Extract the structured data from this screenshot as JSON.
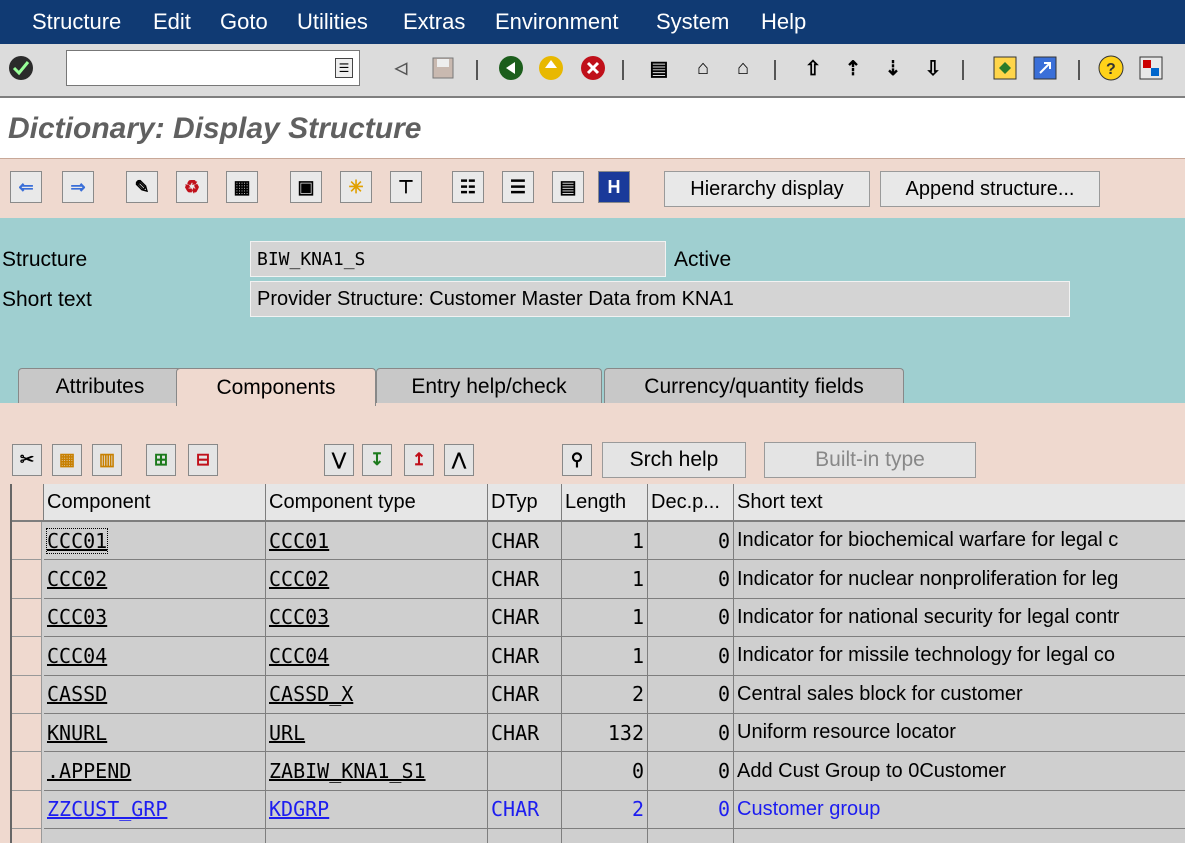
{
  "menu": [
    "Structure",
    "Edit",
    "Goto",
    "Utilities",
    "Extras",
    "Environment",
    "System",
    "Help"
  ],
  "title": "Dictionary: Display Structure",
  "toolbar": {
    "hierarchy_label": "Hierarchy display",
    "append_label": "Append structure..."
  },
  "header": {
    "structure_label": "Structure",
    "structure_value": "BIW_KNA1_S",
    "status": "Active",
    "shorttext_label": "Short text",
    "shorttext_value": "Provider Structure: Customer Master Data from KNA1"
  },
  "tabs": [
    "Attributes",
    "Components",
    "Entry help/check",
    "Currency/quantity fields"
  ],
  "active_tab": "Components",
  "components_toolbar": {
    "srch_help": "Srch help",
    "builtin_type": "Built-in type"
  },
  "table": {
    "columns": [
      "Component",
      "Component type",
      "DTyp",
      "Length",
      "Dec.p...",
      "Short text"
    ],
    "rows": [
      {
        "component": "CCC01",
        "type": "CCC01",
        "dtyp": "CHAR",
        "length": "1",
        "dec": "0",
        "text": "Indicator for biochemical warfare for legal c"
      },
      {
        "component": "CCC02",
        "type": "CCC02",
        "dtyp": "CHAR",
        "length": "1",
        "dec": "0",
        "text": "Indicator for nuclear nonproliferation for leg"
      },
      {
        "component": "CCC03",
        "type": "CCC03",
        "dtyp": "CHAR",
        "length": "1",
        "dec": "0",
        "text": "Indicator for national security for legal contr"
      },
      {
        "component": "CCC04",
        "type": "CCC04",
        "dtyp": "CHAR",
        "length": "1",
        "dec": "0",
        "text": "Indicator for missile technology for legal co"
      },
      {
        "component": "CASSD",
        "type": "CASSD_X",
        "dtyp": "CHAR",
        "length": "2",
        "dec": "0",
        "text": "Central sales block for customer"
      },
      {
        "component": "KNURL",
        "type": "URL",
        "dtyp": "CHAR",
        "length": "132",
        "dec": "0",
        "text": "Uniform resource locator"
      },
      {
        "component": ".APPEND",
        "type": "ZABIW_KNA1_S1",
        "dtyp": "",
        "length": "0",
        "dec": "0",
        "text": "Add Cust Group to 0Customer"
      },
      {
        "component": "ZZCUST_GRP",
        "type": "KDGRP",
        "dtyp": "CHAR",
        "length": "2",
        "dec": "0",
        "text": "Customer group"
      }
    ]
  },
  "colors": {
    "menubar": "#103a73",
    "toolbar_salmon": "#efd9cf",
    "header_teal": "#9fcfd0",
    "append_blue": "#1d1df0"
  }
}
